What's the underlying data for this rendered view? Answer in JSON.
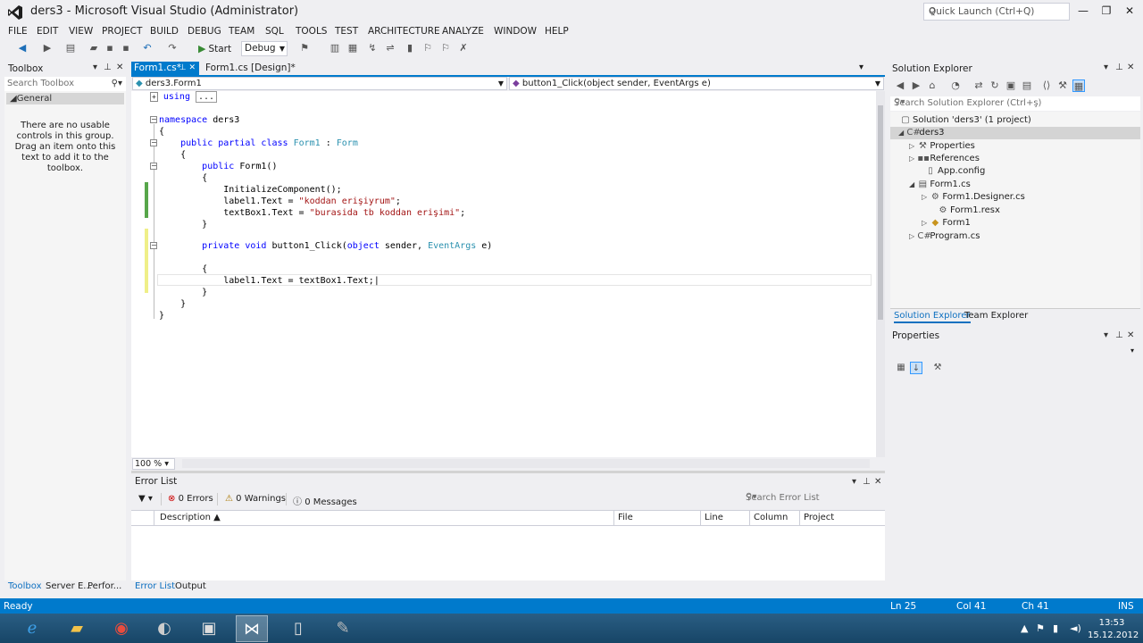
{
  "window": {
    "title": "ders3 - Microsoft Visual Studio (Administrator)",
    "quick_launch_placeholder": "Quick Launch (Ctrl+Q)"
  },
  "menu": [
    "FILE",
    "EDIT",
    "VIEW",
    "PROJECT",
    "BUILD",
    "DEBUG",
    "TEAM",
    "SQL",
    "TOOLS",
    "TEST",
    "ARCHITECTURE",
    "ANALYZE",
    "WINDOW",
    "HELP"
  ],
  "toolbar": {
    "start_label": "Start",
    "config": "Debug"
  },
  "toolbox": {
    "title": "Toolbox",
    "search_placeholder": "Search Toolbox",
    "group": "General",
    "empty_message": "There are no usable controls in this group. Drag an item onto this text to add it to the toolbox."
  },
  "editor": {
    "tabs": [
      {
        "label": "Form1.cs*",
        "active": true
      },
      {
        "label": "Form1.cs [Design]*"
      }
    ],
    "nav_left": "ders3.Form1",
    "nav_right": "button1_Click(object sender, EventArgs e)",
    "using_label": "using",
    "using_ellipsis": "...",
    "zoom": "100 %",
    "code": {
      "ns_kw": "namespace",
      "ns_name": "ders3",
      "open_brace": "{",
      "close_brace": "}",
      "class_mods": "public partial",
      "class_kw": "class",
      "class_name": "Form1",
      "colon": ":",
      "base": "Form",
      "ctor_kw": "public",
      "ctor_name": "Form1()",
      "init": "InitializeComponent();",
      "l1_a": "label1.Text = ",
      "l1_str": "\"koddan erişiyrum\"",
      "l1_end": ";",
      "l2_a": "textBox1.Text = ",
      "l2_str": "\"burasida tb koddan erişimi\"",
      "l2_end": ";",
      "m_kw": "private void",
      "m_name": "button1_Click(",
      "m_obj": "object",
      "m_sender": " sender, ",
      "m_ea": "EventArgs",
      "m_e": " e)",
      "assign": "label1.Text = textBox1.Text;"
    }
  },
  "error_list": {
    "title": "Error List",
    "errors": "0 Errors",
    "warnings": "0 Warnings",
    "messages": "0 Messages",
    "search_placeholder": "Search Error List",
    "columns": [
      "Description",
      "File",
      "Line",
      "Column",
      "Project"
    ]
  },
  "bottom_tabs": [
    "Toolbox",
    "Server E...",
    "Perfor...",
    "Error List",
    "Output"
  ],
  "solution_explorer": {
    "title": "Solution Explorer",
    "search_placeholder": "Search Solution Explorer (Ctrl+ş)",
    "items": [
      {
        "label": "Solution 'ders3' (1 project)"
      },
      {
        "label": "ders3"
      },
      {
        "label": "Properties"
      },
      {
        "label": "References"
      },
      {
        "label": "App.config"
      },
      {
        "label": "Form1.cs"
      },
      {
        "label": "Form1.Designer.cs"
      },
      {
        "label": "Form1.resx"
      },
      {
        "label": "Form1"
      },
      {
        "label": "Program.cs"
      }
    ],
    "tabs": [
      "Solution Explorer",
      "Team Explorer"
    ]
  },
  "properties": {
    "title": "Properties"
  },
  "status": {
    "ready": "Ready",
    "ln": "Ln 25",
    "col": "Col 41",
    "ch": "Ch 41",
    "mode": "INS"
  },
  "clock": {
    "time": "13:53",
    "date": "15.12.2012"
  },
  "colors": {
    "accent": "#007acc",
    "keyword": "#0000ff",
    "type": "#2b91af",
    "string": "#a31515"
  }
}
